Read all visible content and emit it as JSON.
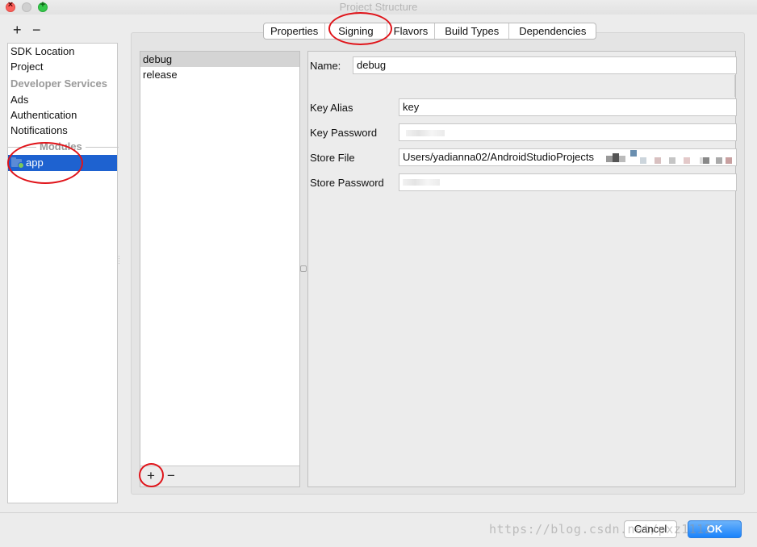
{
  "window": {
    "title": "Project Structure"
  },
  "toolbar": {
    "add_label": "+",
    "remove_label": "−"
  },
  "sidebar": {
    "items": [
      {
        "label": "SDK Location"
      },
      {
        "label": "Project"
      },
      {
        "label": "Developer Services"
      },
      {
        "label": "Ads"
      },
      {
        "label": "Authentication"
      },
      {
        "label": "Notifications"
      }
    ],
    "modules_header": "Modules",
    "module": {
      "label": "app",
      "icon": "module-folder-icon"
    }
  },
  "tabs": [
    {
      "label": "Properties"
    },
    {
      "label": "Signing",
      "active": true
    },
    {
      "label": "Flavors"
    },
    {
      "label": "Build Types"
    },
    {
      "label": "Dependencies"
    }
  ],
  "configs": {
    "items": [
      {
        "label": "debug",
        "selected": true
      },
      {
        "label": "release"
      }
    ],
    "add_label": "+",
    "remove_label": "−"
  },
  "form": {
    "name_label": "Name:",
    "name_value": "debug",
    "key_alias_label": "Key Alias",
    "key_alias_value": "key",
    "key_password_label": "Key Password",
    "store_file_label": "Store File",
    "store_file_value": "Users/yadianna02/AndroidStudioProjects",
    "store_password_label": "Store Password"
  },
  "buttons": {
    "cancel": "Cancel",
    "ok": "OK"
  },
  "watermark": "https://blog.csdn.net/pxz1112",
  "colors": {
    "selection": "#1e62d0",
    "ok_button": "#1a82fb",
    "annotation_circle": "#e0141a"
  }
}
